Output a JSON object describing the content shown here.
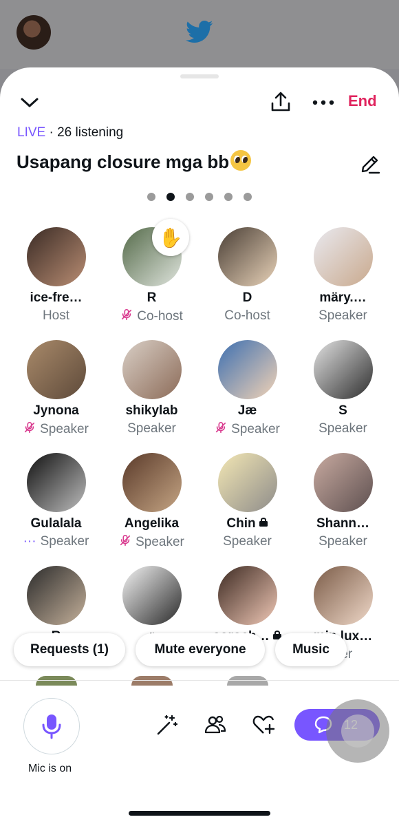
{
  "space": {
    "live_label": "LIVE",
    "listening": "· 26 listening",
    "title": "Usapang closure mga bb",
    "end_label": "End",
    "page_dots": 6,
    "active_dot": 1
  },
  "participants": [
    {
      "name": "ice-fre…",
      "role": "Host",
      "muted": false,
      "av": "linear-gradient(135deg,#3a2b25,#b98d73)"
    },
    {
      "name": "R",
      "role": "Co-host",
      "muted": true,
      "av": "linear-gradient(135deg,#556b4a,#dfe4dd)"
    },
    {
      "name": "D",
      "role": "Co-host",
      "muted": false,
      "av": "linear-gradient(135deg,#4a3f36,#e8d2b8)"
    },
    {
      "name": "märy.…",
      "role": "Speaker",
      "muted": false,
      "av": "linear-gradient(135deg,#e9e9ef,#c9a98d)"
    },
    {
      "name": "Jynona",
      "role": "Speaker",
      "muted": true,
      "av": "linear-gradient(135deg,#a98a6a,#5e4a3a)"
    },
    {
      "name": "shikylab",
      "role": "Speaker",
      "muted": false,
      "av": "linear-gradient(135deg,#d9cfc6,#8c6b58)"
    },
    {
      "name": "Jæ",
      "role": "Speaker",
      "muted": true,
      "av": "linear-gradient(135deg,#3d6fb0,#f2d3b6)"
    },
    {
      "name": "S",
      "role": "Speaker",
      "muted": false,
      "av": "linear-gradient(135deg,#e2e2e2,#2e2e2e)"
    },
    {
      "name": "Gulalala",
      "role": "Speaker",
      "muted": false,
      "more": true,
      "av": "linear-gradient(135deg,#111,#bdbdbd)"
    },
    {
      "name": "Angelika",
      "role": "Speaker",
      "muted": true,
      "av": "linear-gradient(135deg,#5a3a2a,#c5a584)"
    },
    {
      "name": "Chin",
      "role": "Speaker",
      "muted": false,
      "locked": true,
      "av": "linear-gradient(135deg,#f3e7b4,#8e8c8a)"
    },
    {
      "name": "Shann…",
      "role": "Speaker",
      "muted": false,
      "av": "linear-gradient(135deg,#c8aaa0,#5e5050)"
    },
    {
      "name": "R",
      "role": "",
      "muted": false,
      "av": "linear-gradient(135deg,#2b2b2b,#c4b09a)"
    },
    {
      "name": "r",
      "role": "L",
      "muted": false,
      "av": "linear-gradient(135deg,#f4f4f4,#2a2a2a)"
    },
    {
      "name": "soroch…",
      "role": "r",
      "muted": false,
      "locked": true,
      "av": "linear-gradient(135deg,#3d2a22,#f0c8b6)"
    },
    {
      "name": "min lux…",
      "role": "ner",
      "muted": false,
      "av": "linear-gradient(135deg,#7b5c48,#efd8c8)"
    }
  ],
  "actions": {
    "requests": "Requests (1)",
    "mute_everyone": "Mute everyone",
    "music": "Music"
  },
  "bottom": {
    "mic_label": "Mic is on",
    "chat_count": "12"
  },
  "colors": {
    "accent": "#7856ff",
    "end": "#e0245e",
    "muted_icon": "#d93b8f",
    "twitter_blue": "#1d9bf0"
  }
}
